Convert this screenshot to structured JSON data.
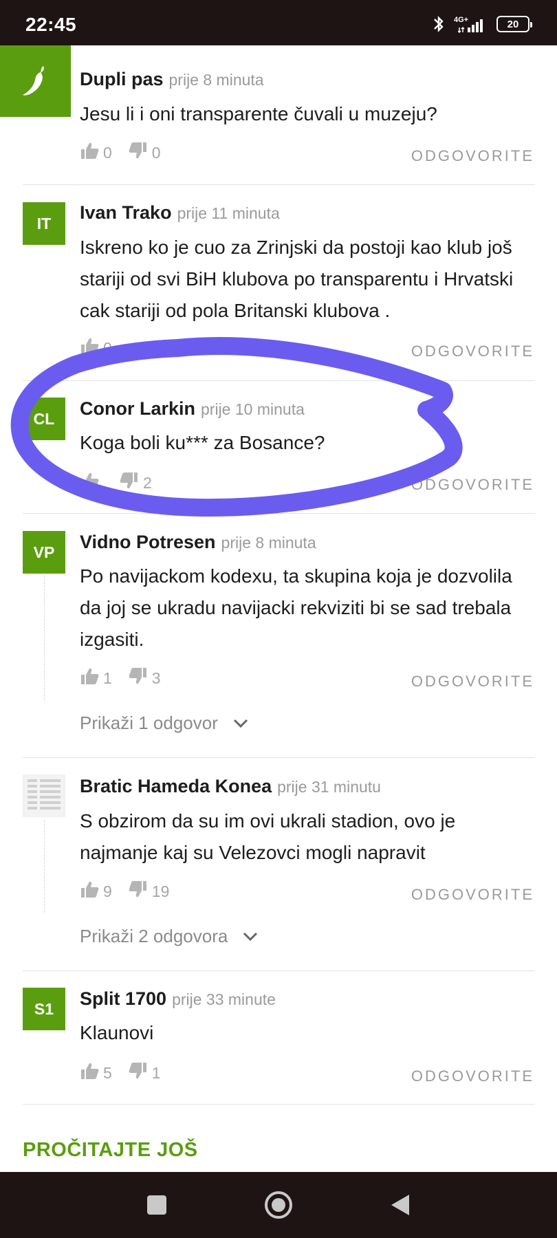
{
  "status_bar": {
    "time": "22:45",
    "network": "4G+",
    "battery": "20"
  },
  "reply_label": "ODGOVORITE",
  "comments": [
    {
      "initials": "",
      "author": "Dupli pas",
      "time": "prije 8 minuta",
      "text": "Jesu li i oni transparente čuvali u muzeju?",
      "likes": "0",
      "dislikes": "0"
    },
    {
      "initials": "IT",
      "author": "Ivan Trako",
      "time": "prije 11 minuta",
      "text": "Iskreno ko je cuo za Zrinjski da postoji kao klub još stariji od svi BiH klubova po transparentu i Hrvatski cak stariji od pola Britanski klubova .",
      "likes": "0",
      "dislikes": ""
    },
    {
      "initials": "CL",
      "author": "Conor Larkin",
      "time": "prije 10 minuta",
      "text": "Koga boli ku*** za Bosance?",
      "likes": "",
      "dislikes": "2"
    },
    {
      "initials": "VP",
      "author": "Vidno Potresen",
      "time": "prije 8 minuta",
      "text": "Po navijackom kodexu, ta skupina koja je dozvolila da joj se ukradu navijacki rekviziti bi se sad trebala izgasiti.",
      "likes": "1",
      "dislikes": "3",
      "replies": "Prikaži 1 odgovor"
    },
    {
      "initials": "",
      "author": "Bratic Hameda Konea",
      "time": "prije 31 minutu",
      "text": "S obzirom da su im ovi ukrali stadion, ovo je najmanje kaj su Velezovci mogli napravit",
      "likes": "9",
      "dislikes": "19",
      "replies": "Prikaži 2 odgovora"
    },
    {
      "initials": "S1",
      "author": "Split 1700",
      "time": "prije 33 minute",
      "text": "Klaunovi",
      "likes": "5",
      "dislikes": "1"
    }
  ],
  "read_more": "PROČITAJTE JOŠ",
  "colors": {
    "brand_green": "#5a9e0f",
    "annotation_purple": "#6b5cf0",
    "bar": "#1f1414"
  }
}
